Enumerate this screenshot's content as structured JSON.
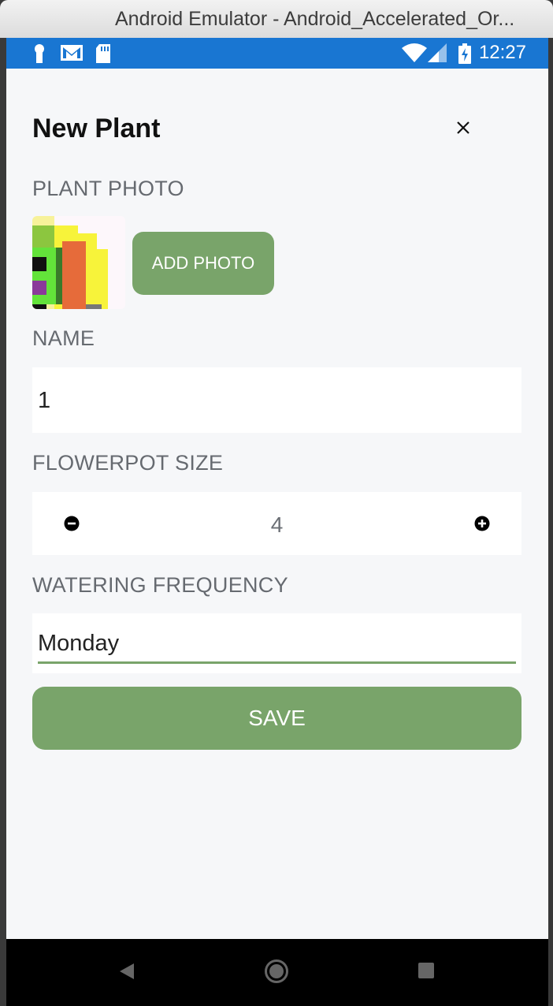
{
  "window": {
    "title": "Android Emulator - Android_Accelerated_Or..."
  },
  "status_bar": {
    "time": "12:27",
    "left_icons": [
      "key-icon",
      "gmail-icon",
      "sd-card-icon"
    ],
    "right_icons": [
      "wifi-icon",
      "signal-icon",
      "battery-charging-icon"
    ],
    "background_color": "#1976d2"
  },
  "header": {
    "title": "New Plant",
    "close_icon": "close-icon"
  },
  "plant_photo": {
    "label": "PLANT PHOTO",
    "add_button_label": "ADD PHOTO"
  },
  "name": {
    "label": "NAME",
    "value": "1"
  },
  "flowerpot": {
    "label": "FLOWERPOT SIZE",
    "value": "4",
    "decrement_icon": "minus-circle-icon",
    "increment_icon": "plus-circle-icon"
  },
  "watering": {
    "label": "WATERING FREQUENCY",
    "value": "Monday"
  },
  "save": {
    "label": "SAVE"
  },
  "nav": {
    "back_icon": "back-triangle-icon",
    "home_icon": "home-circle-icon",
    "recents_icon": "recents-square-icon"
  },
  "colors": {
    "accent": "#79a46a",
    "background": "#f6f7f9",
    "label": "#666a70"
  }
}
